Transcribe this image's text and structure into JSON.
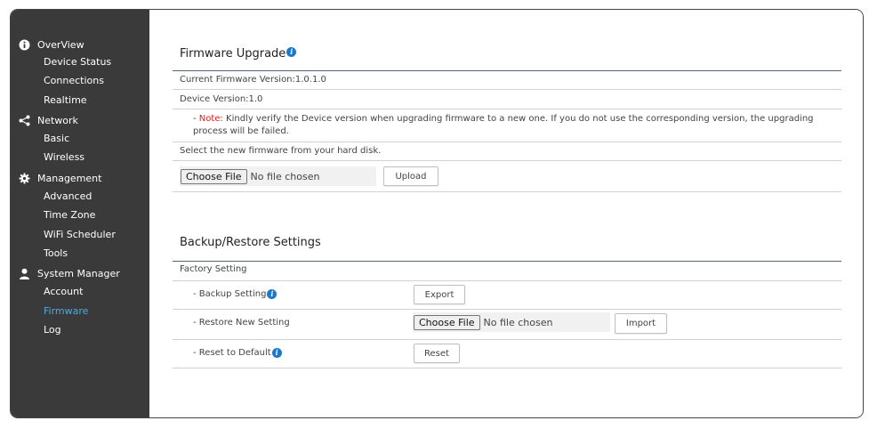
{
  "sidebar": {
    "sections": [
      {
        "label": "OverView",
        "icon": "info-icon",
        "items": [
          "Device Status",
          "Connections",
          "Realtime"
        ]
      },
      {
        "label": "Network",
        "icon": "share-icon",
        "items": [
          "Basic",
          "Wireless"
        ]
      },
      {
        "label": "Management",
        "icon": "gear-icon",
        "items": [
          "Advanced",
          "Time Zone",
          "WiFi Scheduler",
          "Tools"
        ]
      },
      {
        "label": "System Manager",
        "icon": "user-icon",
        "items": [
          "Account",
          "Firmware",
          "Log"
        ]
      }
    ],
    "active_item": "Firmware",
    "active_color": "#4fa8e0"
  },
  "firmware": {
    "title": "Firmware Upgrade",
    "current_version": "Current Firmware Version:1.0.1.0",
    "device_version": "Device Version:1.0",
    "note_prefix": "- ",
    "note_label": "Note:",
    "note_text": " Kindly verify the Device version when upgrading firmware to a new one. If you do not use the corresponding version, the upgrading process will be failed.",
    "select_text": "Select the new firmware from your hard disk.",
    "choose_file_label": "Choose File",
    "no_file_text": "No file chosen",
    "upload_label": "Upload"
  },
  "backup": {
    "title": "Backup/Restore Settings",
    "factory_label": "Factory Setting",
    "backup_label": "- Backup Setting",
    "export_label": "Export",
    "restore_label": "- Restore New Setting",
    "choose_file_label": "Choose File",
    "no_file_text": "No file chosen",
    "import_label": "Import",
    "reset_label": "- Reset to Default",
    "reset_button_label": "Reset"
  },
  "colors": {
    "sidebar_bg": "#3a3a3a",
    "info_icon": "#1e78c8",
    "note_red": "#e02020"
  }
}
